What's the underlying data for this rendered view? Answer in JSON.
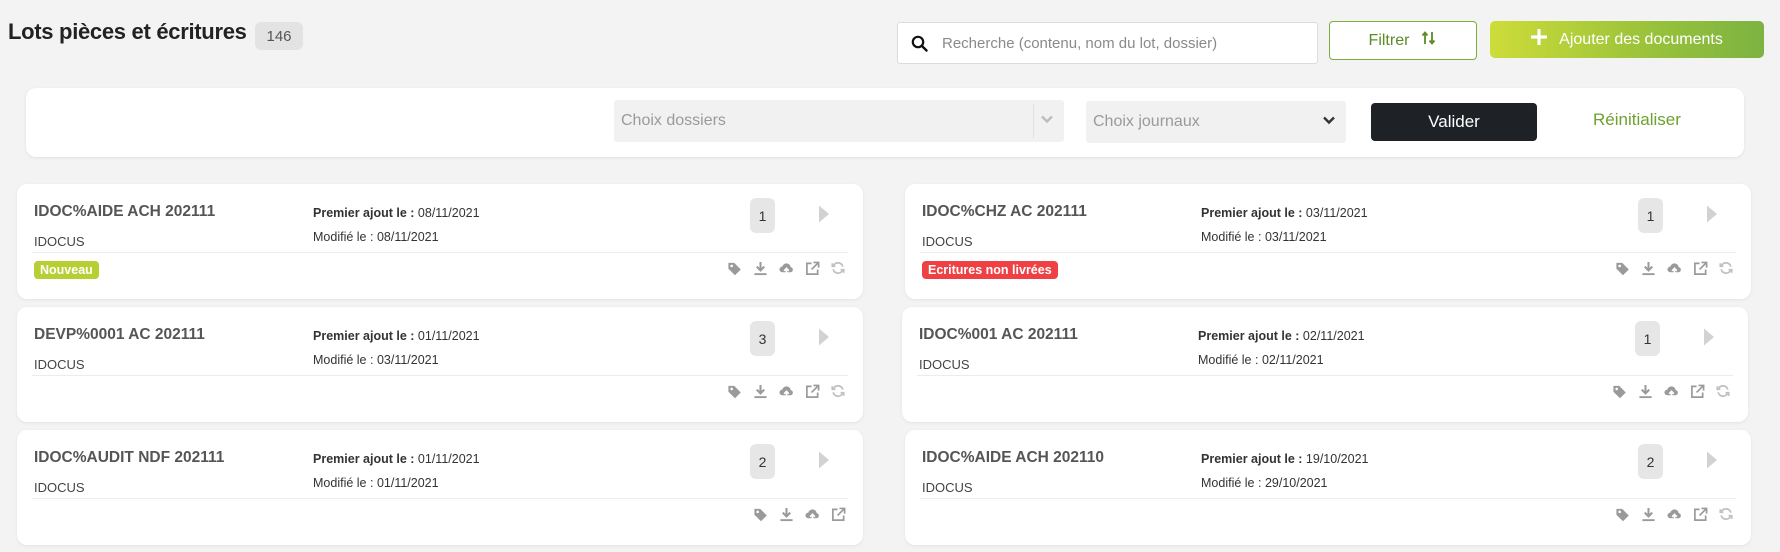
{
  "header": {
    "title": "Lots pièces et écritures",
    "count": "146",
    "search_placeholder": "Recherche (contenu, nom du lot, dossier)",
    "filter_label": "Filtrer",
    "add_docs_label": "Ajouter des documents"
  },
  "filter_bar": {
    "dossiers_placeholder": "Choix dossiers",
    "journaux_placeholder": "Choix journaux",
    "validate_label": "Valider",
    "reset_label": "Réinitialiser"
  },
  "labels": {
    "first_added": "Premier ajout le :",
    "modified": "Modifié le :"
  },
  "colors": {
    "accent_green": "#7cae3c",
    "badge_new": "#b8cf33",
    "badge_error": "#ef4144"
  },
  "cards": [
    {
      "name": "IDOC%AIDE ACH 202111",
      "company": "IDOCUS",
      "first_added": "08/11/2021",
      "modified": "08/11/2021",
      "count": "1",
      "badge": "Nouveau",
      "actions": [
        "tag-icon",
        "download-icon",
        "cloud-upload-icon",
        "external-link-icon",
        "sync-icon"
      ]
    },
    {
      "name": "IDOC%CHZ AC 202111",
      "company": "IDOCUS",
      "first_added": "03/11/2021",
      "modified": "03/11/2021",
      "count": "1",
      "badge": "Ecritures non livrées",
      "actions": [
        "tag-icon",
        "download-icon",
        "cloud-upload-icon",
        "external-link-icon",
        "sync-icon"
      ]
    },
    {
      "name": "DEVP%0001 AC 202111",
      "company": "IDOCUS",
      "first_added": "01/11/2021",
      "modified": "03/11/2021",
      "count": "3",
      "badge": "",
      "actions": [
        "tag-icon",
        "download-icon",
        "cloud-upload-icon",
        "external-link-icon",
        "sync-icon"
      ]
    },
    {
      "name": "IDOC%001 AC 202111",
      "company": "IDOCUS",
      "first_added": "02/11/2021",
      "modified": "02/11/2021",
      "count": "1",
      "badge": "",
      "actions": [
        "tag-icon",
        "download-icon",
        "cloud-upload-icon",
        "external-link-icon",
        "sync-icon"
      ]
    },
    {
      "name": "IDOC%AUDIT NDF 202111",
      "company": "IDOCUS",
      "first_added": "01/11/2021",
      "modified": "01/11/2021",
      "count": "2",
      "badge": "",
      "actions": [
        "tag-icon",
        "download-icon",
        "cloud-upload-icon",
        "external-link-icon"
      ]
    },
    {
      "name": "IDOC%AIDE ACH 202110",
      "company": "IDOCUS",
      "first_added": "19/10/2021",
      "modified": "29/10/2021",
      "count": "2",
      "badge": "",
      "actions": [
        "tag-icon",
        "download-icon",
        "cloud-upload-icon",
        "external-link-icon",
        "sync-icon"
      ]
    }
  ]
}
